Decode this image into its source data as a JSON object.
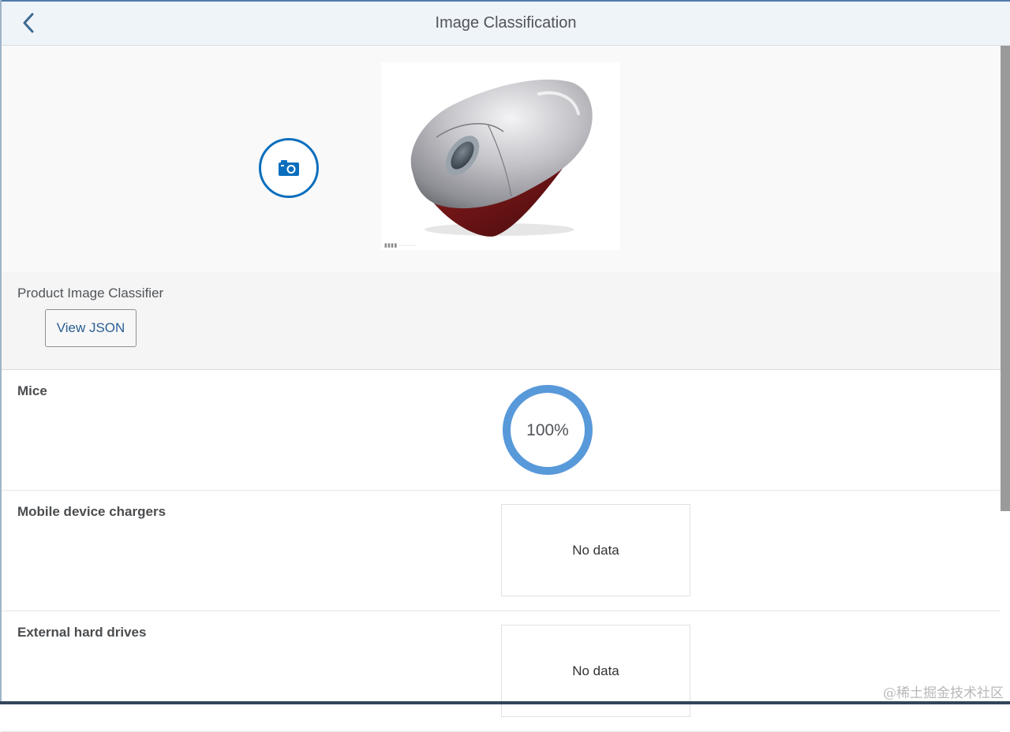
{
  "header": {
    "title": "Image Classification"
  },
  "upload": {
    "preview_caption": ""
  },
  "classifier": {
    "title": "Product Image Classifier",
    "view_json_label": "View JSON"
  },
  "results": [
    {
      "label": "Mice",
      "confidence": 1.0,
      "confidence_text": "100%"
    },
    {
      "label": "Mobile device chargers",
      "no_data": "No data"
    },
    {
      "label": "External hard drives",
      "no_data": "No data"
    }
  ],
  "colors": {
    "accent": "#0a6ebd",
    "gauge": "#5899da",
    "header_bg": "#eff4f9"
  },
  "overlay": {
    "watermark": "@稀土掘金技术社区"
  }
}
